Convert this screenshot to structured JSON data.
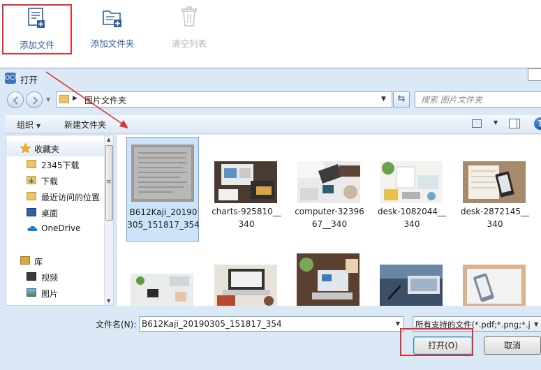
{
  "toolbar": {
    "add_file": "添加文件",
    "add_folder": "添加文件夹",
    "clear_list": "清空列表"
  },
  "dialog": {
    "title": "打开",
    "icon_text": "OCR",
    "address_crumb": "图片文件夹",
    "search_placeholder": "搜索 图片文件夹",
    "organize": "组织",
    "new_folder": "新建文件夹",
    "nav": {
      "favorites": "收藏夹",
      "fav_items": [
        "2345下载",
        "下载",
        "最近访问的位置",
        "桌面",
        "OneDrive"
      ],
      "library": "库",
      "lib_items": [
        "视频",
        "图片"
      ]
    },
    "files": [
      {
        "name": "B612Kaji_20190305_151817_354",
        "selected": true
      },
      {
        "name": "charts-925810__340",
        "selected": false
      },
      {
        "name": "computer-3239667__340",
        "selected": false
      },
      {
        "name": "desk-1082044__340",
        "selected": false
      },
      {
        "name": "desk-2872145__340",
        "selected": false
      }
    ],
    "filename_label": "文件名(N):",
    "filename_value": "B612Kaji_20190305_151817_354",
    "filetype_value": "所有支持的文件(*.pdf;*.png;*.j",
    "open_button": "打开(O)",
    "cancel_button": "取消"
  },
  "colors": {
    "highlight_border": "#e03030",
    "accent_blue": "#2f5f9d",
    "selection": "#cce3f9"
  },
  "icons": [
    "add-file-icon",
    "add-folder-icon",
    "trash-icon",
    "back-icon",
    "forward-icon",
    "folder-icon",
    "refresh-icon",
    "search-icon",
    "view-icon",
    "preview-pane-icon",
    "help-icon",
    "star-icon",
    "library-icon",
    "video-icon",
    "picture-icon",
    "desktop-icon",
    "onedrive-icon",
    "download-icon"
  ]
}
